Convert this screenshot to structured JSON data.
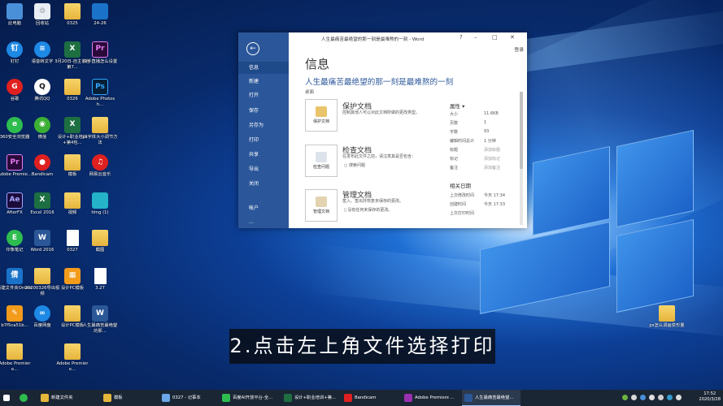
{
  "desktop_icons": [
    {
      "label": "此电脑",
      "kind": "pc",
      "glyph": ""
    },
    {
      "label": "钉钉",
      "kind": "ie",
      "glyph": "钉"
    },
    {
      "label": "谷歌",
      "kind": "red",
      "glyph": "G"
    },
    {
      "label": "360安全浏览器",
      "kind": "green",
      "glyph": "e"
    },
    {
      "label": "Adobe Premie...",
      "kind": "pr",
      "glyph": "Pr"
    },
    {
      "label": "AfterFX",
      "kind": "ae",
      "glyph": "Ae"
    },
    {
      "label": "印象笔记",
      "kind": "green",
      "glyph": "E"
    },
    {
      "label": "新建文件夹Online",
      "kind": "win",
      "glyph": "倩"
    },
    {
      "label": "b7f5ca51b...",
      "kind": "orange",
      "glyph": "✎"
    },
    {
      "label": "Adobe Premiere...",
      "kind": "folder",
      "glyph": ""
    },
    {
      "label": "回收站",
      "kind": "rec",
      "glyph": "♲"
    },
    {
      "label": "语音转文字",
      "kind": "ie",
      "glyph": "≋"
    },
    {
      "label": "腾讯QQ",
      "kind": "qq",
      "glyph": "Q"
    },
    {
      "label": "微信",
      "kind": "wx",
      "glyph": "◉"
    },
    {
      "label": "Bandicam",
      "kind": "red",
      "glyph": "●"
    },
    {
      "label": "Excel 2016",
      "kind": "xl",
      "glyph": "X"
    },
    {
      "label": "Word 2016",
      "kind": "wd",
      "glyph": "W"
    },
    {
      "label": "20200326导出视频",
      "kind": "folder",
      "glyph": ""
    },
    {
      "label": "百度网盘",
      "kind": "ie",
      "glyph": "∞"
    },
    {
      "label": "0325",
      "kind": "folder",
      "glyph": ""
    },
    {
      "label": "3月20日-自主训包第7...",
      "kind": "xl",
      "glyph": "X"
    },
    {
      "label": "0326",
      "kind": "folder",
      "glyph": ""
    },
    {
      "label": "设计+职业培训+第4包...",
      "kind": "xl",
      "glyph": "X"
    },
    {
      "label": "模板",
      "kind": "folder",
      "glyph": ""
    },
    {
      "label": "视频",
      "kind": "folder",
      "glyph": ""
    },
    {
      "label": "0327",
      "kind": "doc",
      "glyph": ""
    },
    {
      "label": "设计PC模板",
      "kind": "orange",
      "glyph": "▦"
    },
    {
      "label": "设计PC模板",
      "kind": "folder",
      "glyph": ""
    },
    {
      "label": "Adobe Premiere...",
      "kind": "folder",
      "glyph": ""
    },
    {
      "label": "24-26",
      "kind": "win",
      "glyph": ""
    },
    {
      "label": "快手直播怎么设置",
      "kind": "pr",
      "glyph": "Pr"
    },
    {
      "label": "Adobe Photosh...",
      "kind": "ps",
      "glyph": "Ps"
    },
    {
      "label": "ps字体大小调节方法",
      "kind": "folder",
      "glyph": ""
    },
    {
      "label": "网易云音乐",
      "kind": "red",
      "glyph": "♫"
    },
    {
      "label": "timg (1)",
      "kind": "teal",
      "glyph": ""
    },
    {
      "label": "截图",
      "kind": "folder",
      "glyph": ""
    },
    {
      "label": "3.27",
      "kind": "doc",
      "glyph": ""
    },
    {
      "label": "人生最痛苦最绝望的那...",
      "kind": "wd",
      "glyph": "W"
    },
    {
      "label": "ps怎么调画变形量",
      "kind": "folder",
      "glyph": ""
    }
  ],
  "word": {
    "window_title": "人生最痛苦最绝望的那一刻是最难熬的一刻 - Word",
    "help": "?",
    "minimize": "–",
    "maximize": "□",
    "close": "✕",
    "signin": "登录",
    "back": "←",
    "nav": [
      "信息",
      "新建",
      "打开",
      "保存",
      "另存为",
      "打印",
      "共享",
      "导出",
      "关闭",
      "帐户",
      "..."
    ],
    "heading": "信息",
    "doc_title": "人生最痛苦最绝望的那一刻是最难熬的一刻",
    "doc_location": "桌面",
    "protect": {
      "card": "保护文档",
      "title": "保护文档",
      "desc": "控制其他人可以对此文档所做的更改类型。"
    },
    "inspect": {
      "card": "检查问题",
      "title": "检查文档",
      "desc": "在发布此文件之前，请注意其是否包含：",
      "item": "搜索问题"
    },
    "manage": {
      "card": "管理文档",
      "title": "管理文档",
      "desc": "签入、签出并恢复未保存的更改。",
      "item": "没有任何未保存的更改。"
    },
    "properties_label": "属性",
    "props": [
      {
        "k": "大小",
        "v": "11.6KB",
        "ph": false
      },
      {
        "k": "页数",
        "v": "1",
        "ph": false
      },
      {
        "k": "字数",
        "v": "93",
        "ph": false
      },
      {
        "k": "编辑时间总计",
        "v": "1 分钟",
        "ph": false
      },
      {
        "k": "标题",
        "v": "添加标题",
        "ph": true
      },
      {
        "k": "标记",
        "v": "添加标记",
        "ph": true
      },
      {
        "k": "备注",
        "v": "添加备注",
        "ph": true
      }
    ],
    "dates_label": "相关日期",
    "dates": [
      {
        "k": "上次修改时间",
        "v": "今天 17:34"
      },
      {
        "k": "创建时间",
        "v": "今天 17:33"
      },
      {
        "k": "上次打印时间",
        "v": ""
      }
    ]
  },
  "caption": "2.点击左上角文件选择打印",
  "taskbar": {
    "items": [
      {
        "label": "新建文件夹",
        "color": "#e6b53c",
        "active": false
      },
      {
        "label": "模板",
        "color": "#e6b53c",
        "active": false
      },
      {
        "label": "0327 - 记事本",
        "color": "#6aa7e8",
        "active": false
      },
      {
        "label": "百度AI开放平台-全...",
        "color": "#2ebc4f",
        "active": false
      },
      {
        "label": "设计+职业培训+第...",
        "color": "#1d6f42",
        "active": false
      },
      {
        "label": "Bandicam",
        "color": "#e02020",
        "active": false
      },
      {
        "label": "Adobe Premiere ...",
        "color": "#9a2fb0",
        "active": false
      },
      {
        "label": "人生最痛苦最绝望...",
        "color": "#2b5797",
        "active": true
      }
    ],
    "time": "17:52",
    "date": "2020/3/28"
  },
  "colors": {
    "word_blue": "#2b579a",
    "taskbar": "#1b2635"
  }
}
